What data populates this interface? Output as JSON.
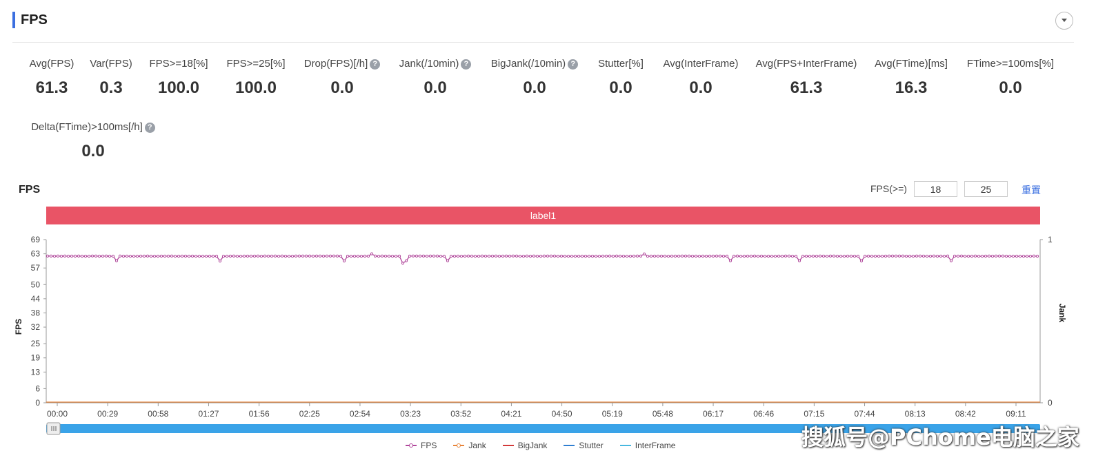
{
  "section": {
    "title": "FPS"
  },
  "metrics": [
    {
      "label": "Avg(FPS)",
      "value": "61.3",
      "help": false
    },
    {
      "label": "Var(FPS)",
      "value": "0.3",
      "help": false
    },
    {
      "label": "FPS>=18[%]",
      "value": "100.0",
      "help": false
    },
    {
      "label": "FPS>=25[%]",
      "value": "100.0",
      "help": false
    },
    {
      "label": "Drop(FPS)[/h]",
      "value": "0.0",
      "help": true
    },
    {
      "label": "Jank(/10min)",
      "value": "0.0",
      "help": true
    },
    {
      "label": "BigJank(/10min)",
      "value": "0.0",
      "help": true
    },
    {
      "label": "Stutter[%]",
      "value": "0.0",
      "help": false
    },
    {
      "label": "Avg(InterFrame)",
      "value": "0.0",
      "help": false
    },
    {
      "label": "Avg(FPS+InterFrame)",
      "value": "61.3",
      "help": false
    },
    {
      "label": "Avg(FTime)[ms]",
      "value": "16.3",
      "help": false
    },
    {
      "label": "FTime>=100ms[%]",
      "value": "0.0",
      "help": false
    },
    {
      "label": "Delta(FTime)>100ms[/h]",
      "value": "0.0",
      "help": true
    }
  ],
  "help_glyph": "?",
  "chart_header": {
    "title": "FPS",
    "threshold_label": "FPS(>=)",
    "threshold_1": "18",
    "threshold_2": "25",
    "reset_label": "重置",
    "band_label": "label1"
  },
  "chart_data": {
    "type": "line",
    "ylabel": "FPS",
    "y2label": "Jank",
    "y_ticks": [
      "0",
      "6",
      "13",
      "19",
      "25",
      "32",
      "38",
      "44",
      "50",
      "57",
      "63",
      "69"
    ],
    "ylim": [
      0,
      69
    ],
    "y2_ticks": [
      "0",
      "1"
    ],
    "y2lim": [
      0,
      1
    ],
    "x_ticks": [
      "00:00",
      "00:29",
      "00:58",
      "01:27",
      "01:56",
      "02:25",
      "02:54",
      "03:23",
      "03:52",
      "04:21",
      "04:50",
      "05:19",
      "05:48",
      "06:17",
      "06:46",
      "07:15",
      "07:44",
      "08:13",
      "08:42",
      "09:11"
    ],
    "duration_seconds": 578,
    "fps_baseline": 61,
    "fps_alt_high": 62,
    "fps_dips": [
      [
        10,
        60
      ],
      [
        170,
        60
      ],
      [
        320,
        60
      ],
      [
        500,
        60
      ],
      [
        584,
        59
      ],
      [
        590,
        60
      ],
      [
        650,
        60
      ],
      [
        1060,
        60
      ],
      [
        1160,
        60
      ],
      [
        1250,
        60
      ],
      [
        1380,
        60
      ]
    ],
    "fps_peaks": [
      [
        540,
        63
      ],
      [
        935,
        63
      ],
      [
        1310,
        62
      ]
    ],
    "series": [
      {
        "name": "FPS",
        "color": "#b0479b"
      },
      {
        "name": "Jank",
        "color": "#e8853a",
        "values": [
          0
        ]
      },
      {
        "name": "BigJank",
        "color": "#d33a3a",
        "values": [
          0
        ]
      },
      {
        "name": "Stutter",
        "color": "#2f7fd1",
        "values": [
          0
        ]
      },
      {
        "name": "InterFrame",
        "color": "#48b8e0",
        "values": [
          0
        ]
      }
    ],
    "grid": false,
    "legend": "bottom"
  },
  "watermark": "搜狐号@PChome电脑之家"
}
